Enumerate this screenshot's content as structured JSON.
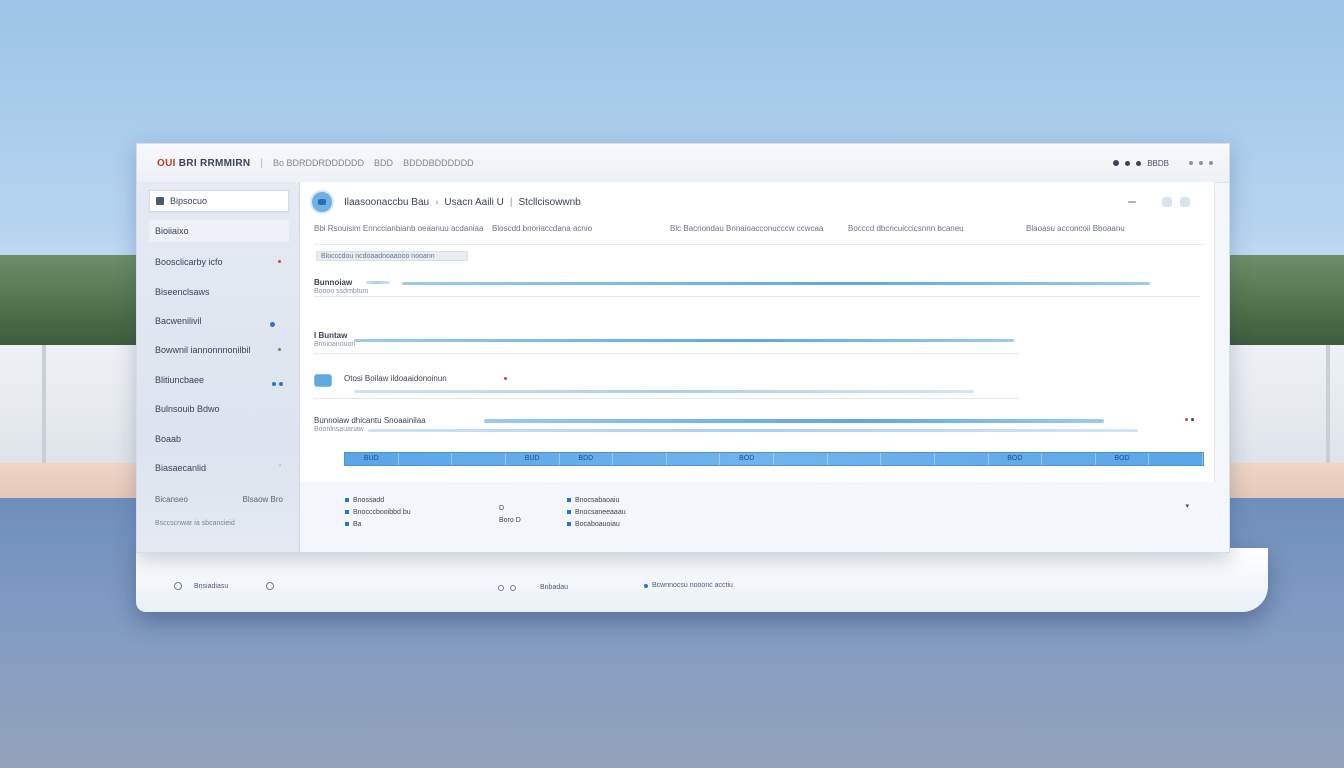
{
  "window": {
    "brand_accent": "OUI",
    "brand_text": "BRI RRMMIRN",
    "breadcrumb": [
      "Bo BDRDDRDDDDDD",
      "BDD",
      "BDDDBDDDDDD"
    ],
    "status_text": "BBDB"
  },
  "sidebar": {
    "items": [
      {
        "label": "Bipsocuo"
      },
      {
        "label": "Bioiiaixo"
      },
      {
        "label": "Boosclicarby icfo"
      },
      {
        "label": "Biseenclsaws"
      },
      {
        "label": "Bacwenilivil"
      },
      {
        "label": "Bowwnil iannonnnonilbil"
      },
      {
        "label": "Blitiuncbaee"
      },
      {
        "label": "Bulnsouib Bdwo"
      },
      {
        "label": "Boaab"
      },
      {
        "label": "Biasaecanlid"
      },
      {
        "label": "Bicanseo"
      },
      {
        "label": "Blsaow Bro"
      },
      {
        "label": "Bsccscnwar ia sbcancieid"
      }
    ]
  },
  "main": {
    "header": {
      "title": "Ilaasoonaccbu Bau",
      "mid": "Usacn Aaili U",
      "right": "Stcllcisowwnb"
    },
    "columns": [
      "Bbi Rsouisim Ennccianbianb oeaanuu acdaniaa",
      "Bloscdd bnoriaccdana acnio",
      "Blc Bacnondau Bnnaioacconucccw ccwcaa",
      "Bocccd dbcncuiccicsnnn bcaneu",
      "Blaoasu acconcoii Bboaanu"
    ],
    "filter": "Blocccdou ncdoaadnoaaooo nooann",
    "rows": [
      {
        "label": "Bunnoiaw",
        "sub": "Boooo ssdmbtum"
      },
      {
        "label": "I Buntaw",
        "sub": "Bnoioanouon"
      },
      {
        "label": "Otosi Boilaw ildoaaidonoinun",
        "sub": ""
      },
      {
        "label": "Bunnoiaw dhicantu Snoaainilaa",
        "sub": "Boonlnsauanaw"
      }
    ],
    "timeline": [
      "BUD",
      "",
      "",
      "BUD",
      "BDD",
      "",
      "",
      "BOD",
      "",
      "",
      "",
      "",
      "BOD",
      "",
      "BOD",
      ""
    ]
  },
  "legend": {
    "left": [
      "Bnossadd",
      "Bnocccbooibbd bu",
      "Ba"
    ],
    "middle": [
      "D",
      "Boro D"
    ],
    "right": [
      "Bnocsabaoaiu",
      "Bnocsaneeaaau",
      "Bocaboauoiau"
    ]
  },
  "footer": {
    "left_label": "Bnsiadiasu",
    "mid_label": "Bnbadau",
    "right_label": "Bcwnnocsu nooonc acctiu"
  }
}
